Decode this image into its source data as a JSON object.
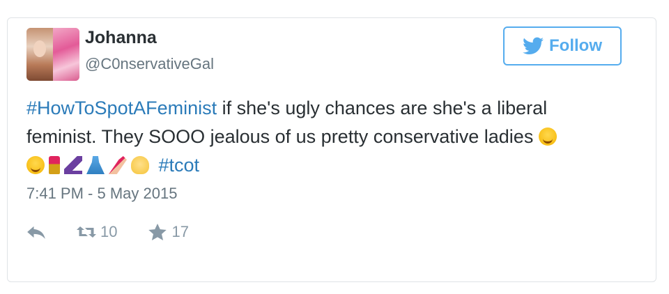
{
  "tweet": {
    "author": {
      "name": "Johanna",
      "handle": "@C0nservativeGal"
    },
    "follow_label": "Follow",
    "text": {
      "hashtag1": "#HowToSpotAFeminist",
      "line1_rest": " if she's ugly chances are she's a liberal",
      "line2": "feminist. They SOOO jealous of us pretty conservative ladies",
      "hashtag2": "#tcot"
    },
    "emojis_line3": [
      "smile-emoji",
      "lipstick-emoji",
      "high-heel-emoji",
      "dress-emoji",
      "nail-polish-emoji",
      "raising-hands-emoji"
    ],
    "timestamp": "7:41 PM - 5 May 2015",
    "stats": {
      "retweets": "10",
      "favorites": "17"
    }
  },
  "colors": {
    "link": "#2b7bb9",
    "follow": "#55acee",
    "muted": "#8899a6",
    "text": "#292f33"
  },
  "icons": {
    "reply": "reply-icon",
    "retweet": "retweet-icon",
    "favorite": "star-icon",
    "twitter": "twitter-bird-icon"
  }
}
